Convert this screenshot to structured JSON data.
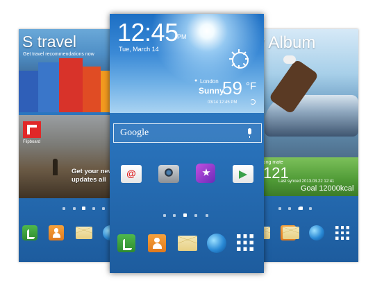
{
  "left_screen": {
    "travel": {
      "title": "S travel",
      "subtitle": "Get travel recommendations now"
    },
    "flipboard": {
      "name": "Flipboard",
      "text": "Get your new updates all"
    }
  },
  "center_screen": {
    "clock": {
      "time": "12:45",
      "ampm": "PM",
      "date": "Tue, March 14"
    },
    "weather": {
      "city": "London",
      "condition": "Sunny",
      "temp": "59",
      "unit": "°F",
      "updated": "03/14 12:45 PM"
    },
    "search": {
      "label": "Google"
    },
    "apps": [
      "email-icon",
      "camera-icon",
      "samsung-hub-icon",
      "play-store-icon"
    ],
    "dock": [
      "phone-icon",
      "contacts-icon",
      "messages-icon",
      "internet-icon",
      "apps-icon"
    ]
  },
  "right_screen": {
    "album": {
      "title": "y Album"
    },
    "walking": {
      "label": "lking mate",
      "steps": "121",
      "synced": "Last synced 2013.03.22 12:41",
      "goal": "Goal 12000kcal"
    }
  },
  "colors": {
    "screen_blue": "#2a74bd",
    "phone_green": "#3aa14a",
    "contacts_orange": "#e88a2a",
    "flipboard_red": "#e12828"
  }
}
